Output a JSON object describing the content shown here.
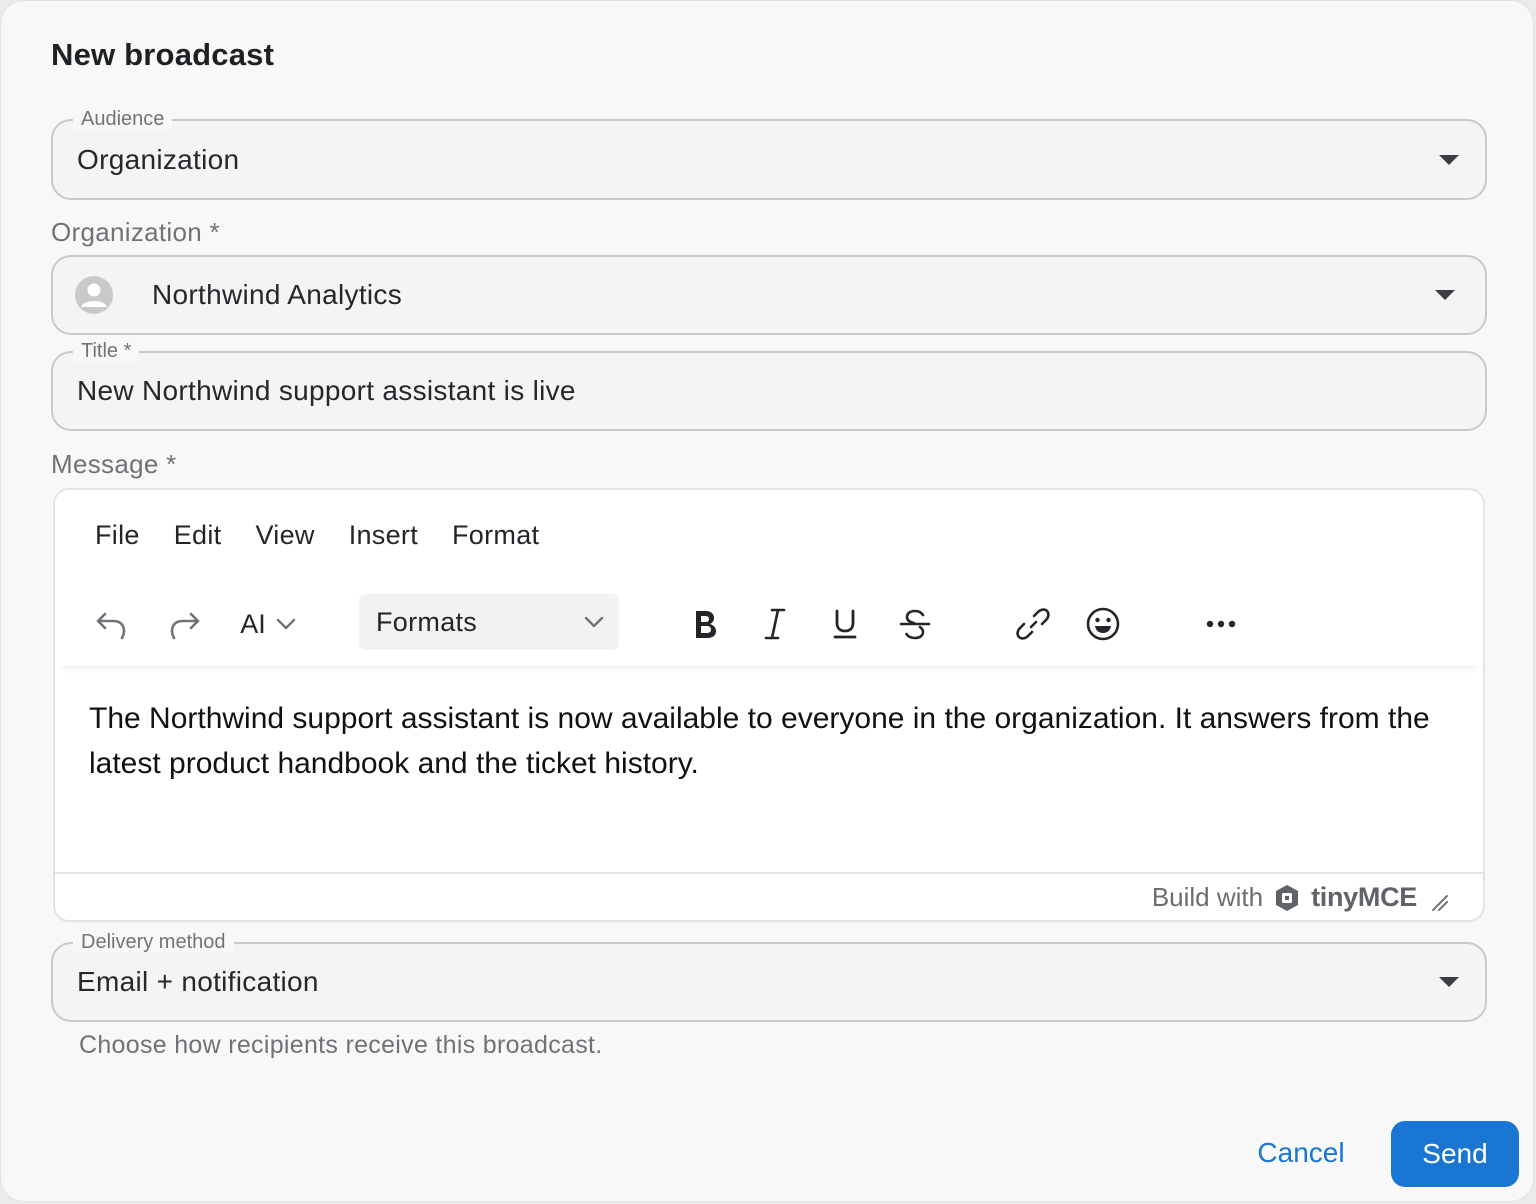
{
  "dialog": {
    "title": "New broadcast"
  },
  "audience": {
    "label": "Audience",
    "value": "Organization"
  },
  "organization": {
    "label": "Organization *",
    "value": "Northwind Analytics"
  },
  "title_field": {
    "label": "Title *",
    "value": "New Northwind support assistant is live"
  },
  "message": {
    "label": "Message *",
    "menubar": [
      "File",
      "Edit",
      "View",
      "Insert",
      "Format"
    ],
    "toolbar": {
      "ai_label": "AI",
      "formats_label": "Formats",
      "icons": [
        "undo-icon",
        "redo-icon",
        "bold-icon",
        "italic-icon",
        "underline-icon",
        "strikethrough-icon",
        "link-icon",
        "emoji-icon",
        "more-icon"
      ]
    },
    "body": "The Northwind support assistant is now available to everyone in the organization. It answers from the latest product handbook and the ticket history.",
    "statusbar": {
      "build_with": "Build with",
      "brand": "tinyMCE"
    }
  },
  "delivery": {
    "label": "Delivery method",
    "value": "Email + notification",
    "helper": "Choose how recipients receive this broadcast."
  },
  "actions": {
    "cancel_label": "Cancel",
    "send_label": "Send"
  },
  "colors": {
    "primary": "#1976d2",
    "text": "#1f2328",
    "muted": "#6f7377",
    "border": "#c9c9c9"
  }
}
